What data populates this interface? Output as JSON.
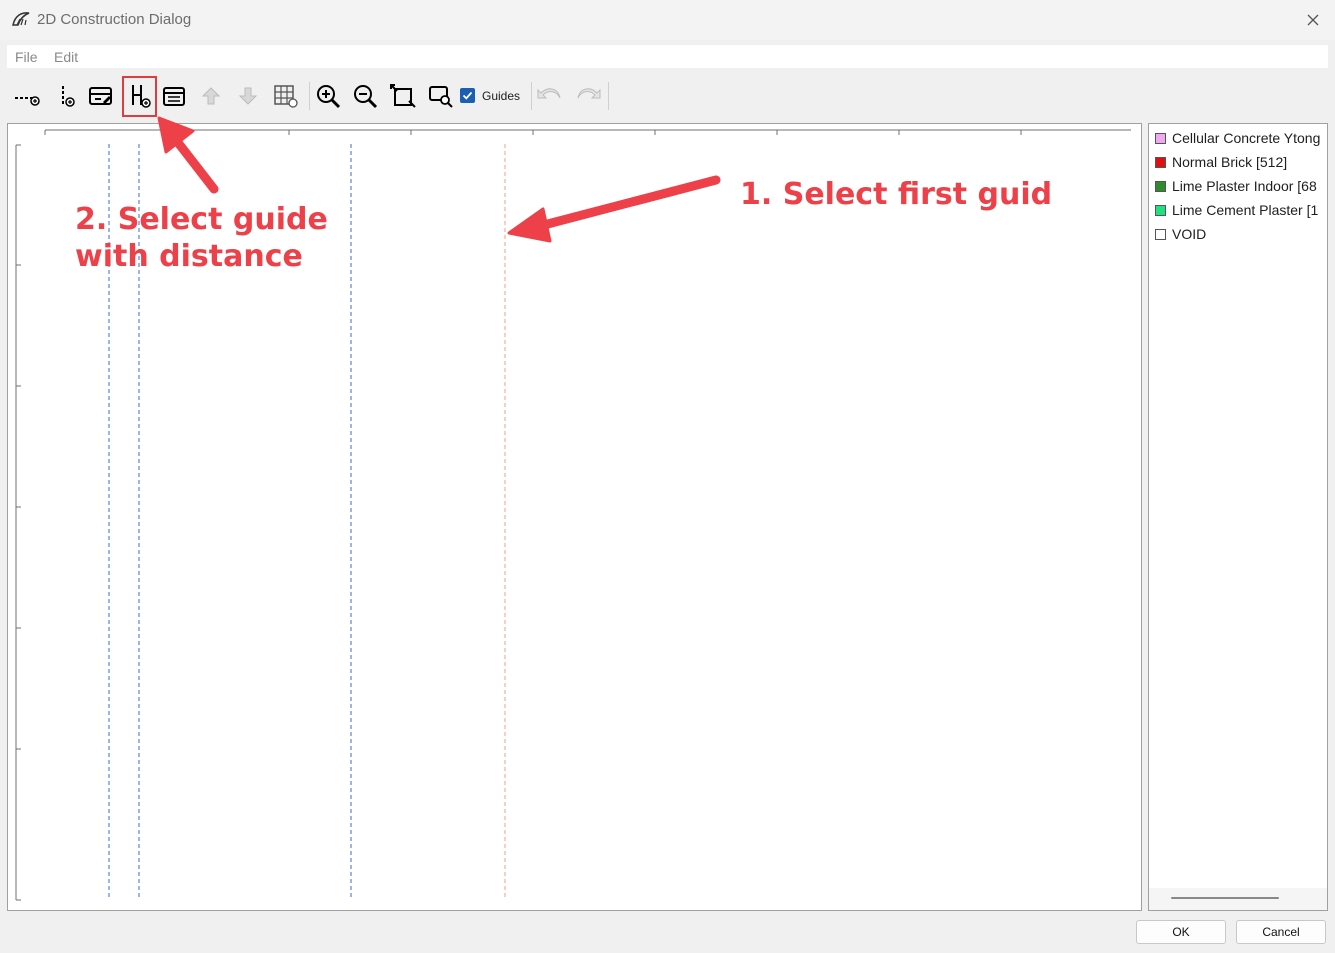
{
  "window": {
    "title": "2D Construction Dialog",
    "app_icon": "app-logo-icon",
    "close_icon": "close-icon"
  },
  "menu": {
    "file": "File",
    "edit": "Edit"
  },
  "toolbar": {
    "tools": [
      "add-horizontal-guide-icon",
      "add-vertical-guide-icon",
      "edit-layer-icon",
      "add-guide-with-distance-icon",
      "layer-properties-icon",
      "move-up-icon",
      "move-down-icon",
      "grid-settings-icon",
      "zoom-in-icon",
      "zoom-out-icon",
      "zoom-fit-icon",
      "zoom-window-icon",
      "undo-icon",
      "redo-icon"
    ],
    "guides_label": "Guides",
    "guides_checked": true
  },
  "legend": {
    "items": [
      {
        "label": "Cellular Concrete Ytong",
        "color": "#f0a8f0"
      },
      {
        "label": "Normal Brick [512]",
        "color": "#e01010"
      },
      {
        "label": "Lime Plaster Indoor [68",
        "color": "#2e8b2e"
      },
      {
        "label": "Lime Cement Plaster [1",
        "color": "#20e080"
      },
      {
        "label": "VOID",
        "color": "#ffffff"
      }
    ]
  },
  "annotations": {
    "step1": "1. Select first guid",
    "step2_line1": "2. Select guide",
    "step2_line2": "with distance",
    "color": "#ee4048"
  },
  "guide_colors": {
    "blue": "#3a6bd8",
    "orange": "#f0a080"
  },
  "buttons": {
    "ok": "OK",
    "cancel": "Cancel"
  }
}
